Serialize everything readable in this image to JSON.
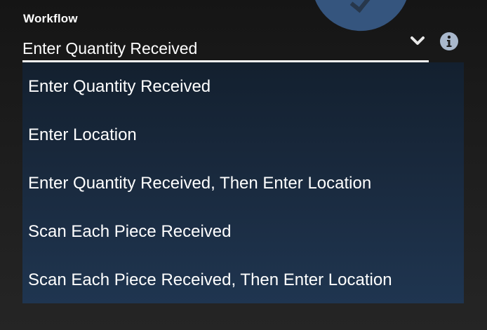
{
  "workflow": {
    "label": "Workflow",
    "selected_value": "Enter Quantity Received",
    "options": [
      "Enter Quantity Received",
      "Enter Location",
      "Enter Quantity Received, Then Enter Location",
      "Scan Each Piece Received",
      "Scan Each Piece Received, Then Enter Location"
    ]
  },
  "icons": {
    "expand": "chevron-down-icon",
    "info": "info-icon"
  },
  "colors": {
    "accent_blue": "#35557e",
    "dropdown_bg": "#19293d",
    "text": "#ffffff"
  }
}
